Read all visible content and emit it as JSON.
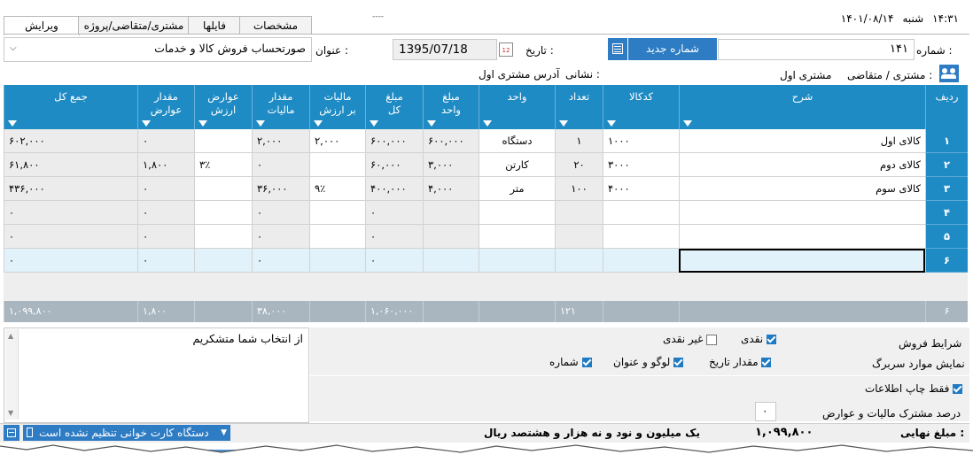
{
  "tabs": [
    "ویرایش",
    "مشتری/متقاضی/پروژه",
    "فایلها",
    "مشخصات"
  ],
  "topbar": {
    "day": "شنبه",
    "date": "۱۴۰۱/۰۸/۱۴",
    "time": "۱۴:۳۱",
    "handle": "----"
  },
  "form": {
    "number_label": "شماره :",
    "number_value": "۱۴۱",
    "new_number_label": "شماره جدید",
    "date_label": "تاریخ :",
    "date_value": "1395/07/18",
    "title_label": "عنوان :",
    "title_value": "صورتحساب فروش کالا و خدمات",
    "customer_label": "مشتری / متقاضی :",
    "customer_value": "مشتری اول",
    "address_label": "نشانی :",
    "address_value": "آدرس مشتری اول"
  },
  "grid": {
    "headers": {
      "row": "ردیف",
      "desc": "شرح",
      "code": "کدکالا",
      "qty": "تعداد",
      "unit": "واحد",
      "unit_price_1": "مبلغ",
      "unit_price_2": "واحد",
      "total_1": "مبلغ",
      "total_2": "کل",
      "tax_1": "مالیات",
      "tax_2": "بر ارزش",
      "tax_amt_1": "مقدار",
      "tax_amt_2": "مالیات",
      "duty_1": "عوارض",
      "duty_2": "ارزش",
      "duty_amt_1": "مقدار",
      "duty_amt_2": "عوارض",
      "sum": "جمع کل"
    },
    "rows": [
      {
        "n": "۱",
        "desc": "کالای اول",
        "code": "۱۰۰۰",
        "qty": "۱",
        "unit": "دستگاه",
        "uprice": "۶۰۰,۰۰۰",
        "total": "۶۰۰,۰۰۰",
        "tax": "۲,۰۰۰",
        "taxamt": "۲,۰۰۰",
        "duty": "",
        "dutyamt": "۰",
        "sum": "۶۰۲,۰۰۰"
      },
      {
        "n": "۲",
        "desc": "کالای دوم",
        "code": "۳۰۰۰",
        "qty": "۲۰",
        "unit": "کارتن",
        "uprice": "۳,۰۰۰",
        "total": "۶۰,۰۰۰",
        "tax": "",
        "taxamt": "۰",
        "duty": "۳٪",
        "dutyamt": "۱,۸۰۰",
        "sum": "۶۱,۸۰۰"
      },
      {
        "n": "۳",
        "desc": "کالای سوم",
        "code": "۴۰۰۰",
        "qty": "۱۰۰",
        "unit": "متر",
        "uprice": "۴,۰۰۰",
        "total": "۴۰۰,۰۰۰",
        "tax": "۹٪",
        "taxamt": "۳۶,۰۰۰",
        "duty": "",
        "dutyamt": "۰",
        "sum": "۴۳۶,۰۰۰"
      },
      {
        "n": "۴",
        "desc": "",
        "code": "",
        "qty": "",
        "unit": "",
        "uprice": "",
        "total": "۰",
        "tax": "",
        "taxamt": "۰",
        "duty": "",
        "dutyamt": "۰",
        "sum": "۰"
      },
      {
        "n": "۵",
        "desc": "",
        "code": "",
        "qty": "",
        "unit": "",
        "uprice": "",
        "total": "۰",
        "tax": "",
        "taxamt": "۰",
        "duty": "",
        "dutyamt": "۰",
        "sum": "۰"
      },
      {
        "n": "۶",
        "desc": "",
        "code": "",
        "qty": "",
        "unit": "",
        "uprice": "",
        "total": "۰",
        "tax": "",
        "taxamt": "۰",
        "duty": "",
        "dutyamt": "۰",
        "sum": "۰"
      }
    ],
    "footer": {
      "count": "۶",
      "qty": "۱۲۱",
      "total": "۱,۰۶۰,۰۰۰",
      "taxamt": "۳۸,۰۰۰",
      "dutyamt": "۱,۸۰۰",
      "sum": "۱,۰۹۹,۸۰۰"
    }
  },
  "options": {
    "sale_terms": "شرایط فروش",
    "cash": "نقدی",
    "noncash": "غیر نقدی",
    "show_header": "نمایش موارد سربرگ",
    "amount_date": "مقدار تاریخ",
    "logo_title": "لوگو و عنوان",
    "number": "شماره",
    "print_info_only": "فقط چاپ اطلاعات",
    "tax_percent_label": "درصد مشترک مالیات و عوارض",
    "tax_percent_value": "۰",
    "notes": "از انتخاب شما متشکریم"
  },
  "status": {
    "final_label": "مبلغ نهایی :",
    "final_value": "۱,۰۹۹,۸۰۰",
    "final_words": "یک میلیون و نود و نه هزار و هشتصد ریال",
    "card_reader": "دستگاه کارت خوانی تنظیم نشده است"
  }
}
